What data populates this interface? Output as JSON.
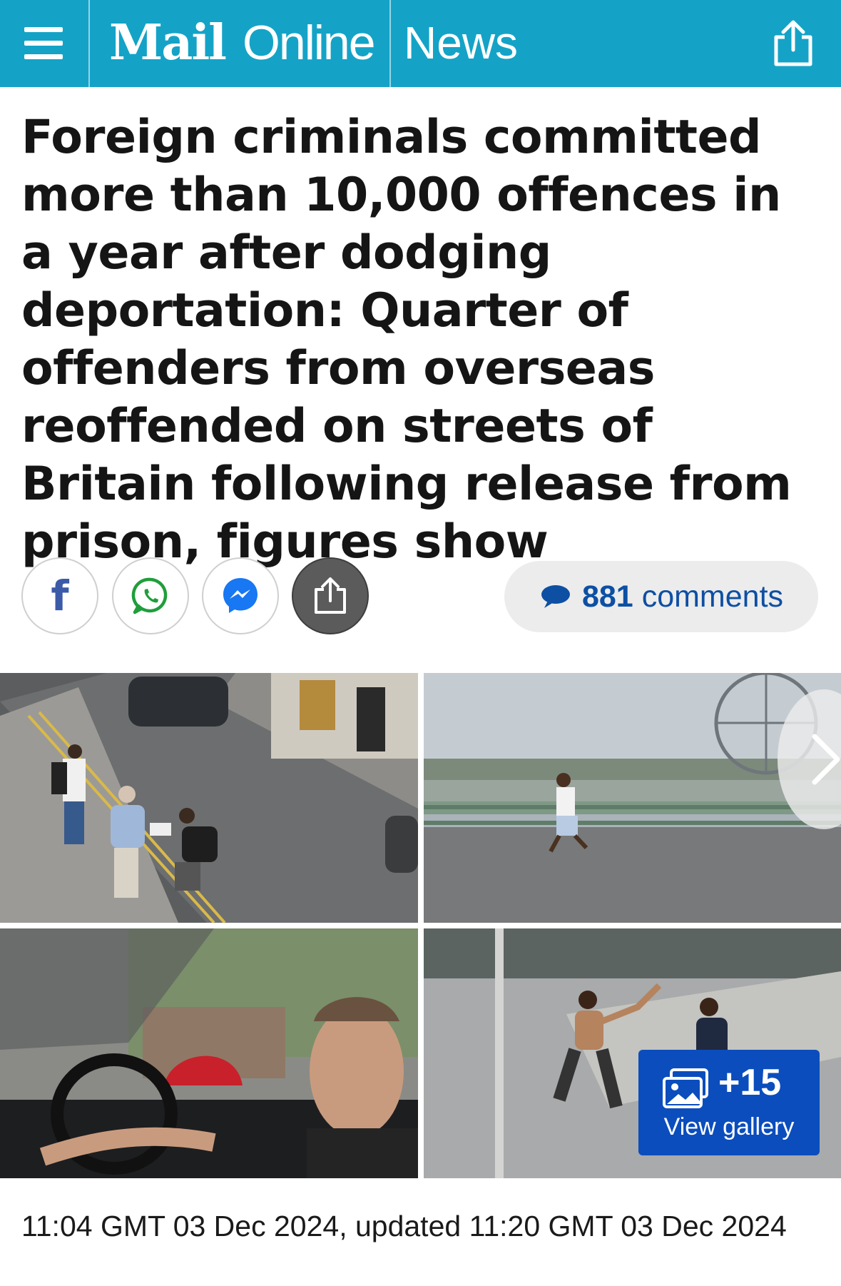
{
  "topbar": {
    "logo_mail": "Mail",
    "logo_online": "Online",
    "section": "News",
    "background_color": "#14a3c7",
    "menu_icon": "hamburger-menu-icon",
    "share_icon": "share-icon"
  },
  "article": {
    "headline": "Foreign criminals committed more than 10,000 offences in a year after dodging deportation: Quarter of offenders from overseas reoffended on streets of Britain following release from prison, figures show",
    "timestamp": "11:04 GMT 03 Dec 2024, updated 11:20 GMT 03 Dec 2024"
  },
  "share_buttons": [
    {
      "name": "facebook",
      "icon": "facebook-icon",
      "color": "#3b5ba8"
    },
    {
      "name": "whatsapp",
      "icon": "whatsapp-icon",
      "color": "#1f9e3b"
    },
    {
      "name": "messenger",
      "icon": "messenger-icon",
      "color": "#1877f2"
    },
    {
      "name": "share",
      "icon": "share-icon",
      "color": "#5b5b5b"
    }
  ],
  "comments": {
    "count": "881",
    "label": "comments",
    "color": "#0d4fa3",
    "icon": "comment-bubble-icon"
  },
  "gallery": {
    "images": [
      {
        "description": "cctv-street-scene",
        "icon": "photo"
      },
      {
        "description": "westminster-bridge-running",
        "icon": "photo"
      },
      {
        "description": "man-driving-sports-car",
        "icon": "photo"
      },
      {
        "description": "man-with-weapon-street",
        "icon": "photo"
      }
    ],
    "next_icon": "chevron-right-icon",
    "extra_count": "+15",
    "view_label": "View gallery",
    "button_color": "#0b4dbd",
    "gallery_icon": "photo-stack-icon"
  }
}
